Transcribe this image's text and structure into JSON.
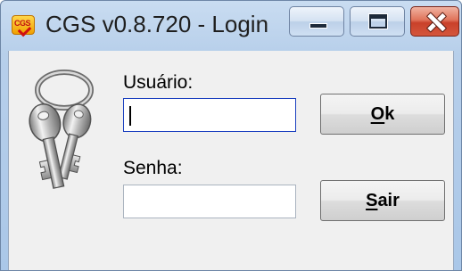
{
  "window": {
    "title": "CGS v0.8.720 - Login",
    "app_icon_text": "CGS",
    "title_bar_color": "#b9d1ea",
    "close_button_color": "#c9412a"
  },
  "form": {
    "user_label": "Usuário:",
    "user_value": "",
    "password_label": "Senha:",
    "password_value": "",
    "focused_field": "user"
  },
  "buttons": {
    "ok_mnemonic": "O",
    "ok_rest": "k",
    "exit_mnemonic": "S",
    "exit_rest": "air"
  },
  "icons": {
    "app": "cgs-logo-icon",
    "login_image": "keys-icon",
    "minimize": "minimize-icon",
    "maximize": "maximize-icon",
    "close": "close-icon"
  }
}
